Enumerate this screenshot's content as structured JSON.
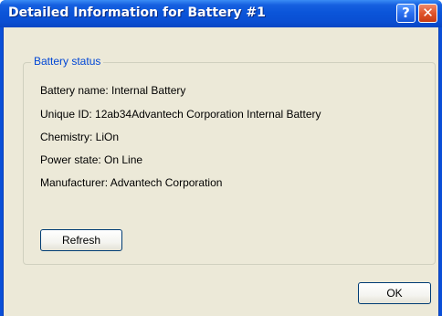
{
  "window": {
    "title": "Detailed Information for Battery #1",
    "help_glyph": "?",
    "close_glyph": "✕"
  },
  "group": {
    "label": "Battery status"
  },
  "info": {
    "battery_name": "Battery name:   Internal Battery",
    "unique_id": "Unique ID:  12ab34Advantech Corporation Internal Battery",
    "chemistry": "Chemistry:   LiOn",
    "power_state": "Power state:  On Line",
    "manufacturer": "Manufacturer:   Advantech Corporation"
  },
  "buttons": {
    "refresh_label": "Refresh",
    "ok_label": "OK"
  },
  "colors": {
    "titlebar": "#0a4ed2",
    "dialog_bg": "#ece9d8",
    "group_label": "#0046d5"
  }
}
